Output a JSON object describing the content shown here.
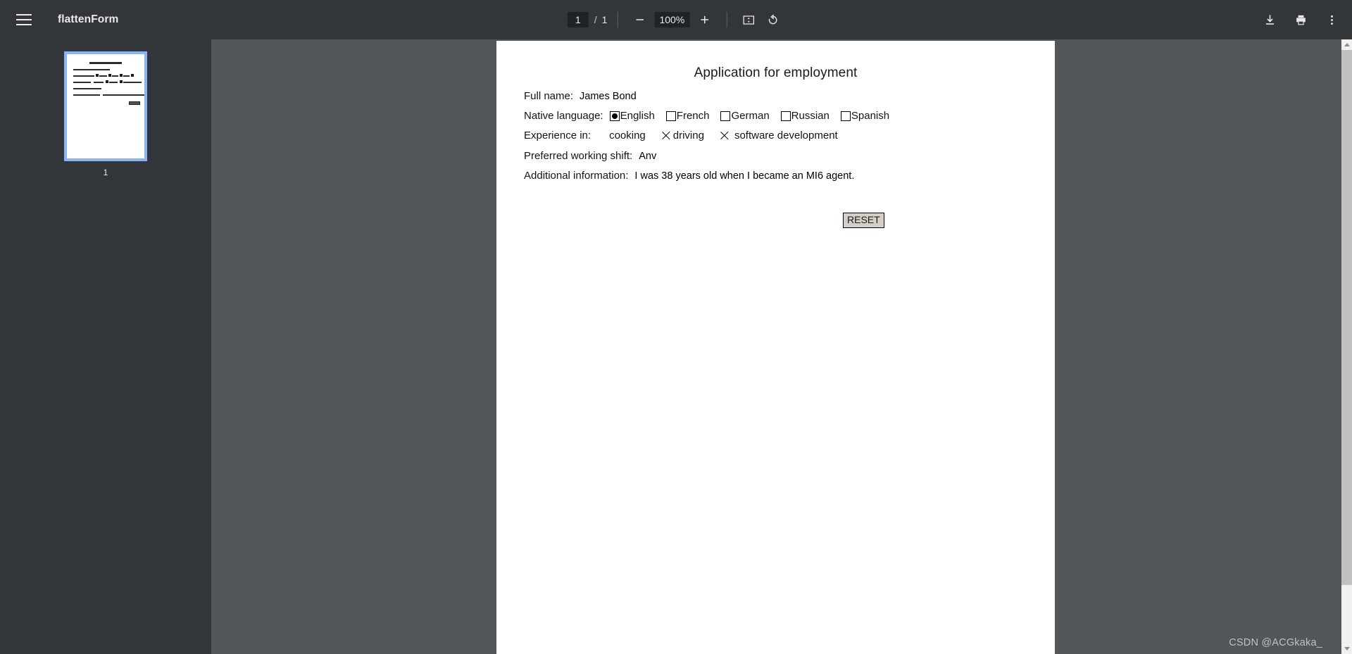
{
  "app": {
    "title": "flattenForm",
    "menu_icon": "hamburger-menu-icon"
  },
  "toolbar": {
    "page_current": "1",
    "page_separator": "/",
    "page_total": "1",
    "zoom_out_icon": "minus-icon",
    "zoom_level": "100%",
    "zoom_in_icon": "plus-icon",
    "fit_page_icon": "fit-to-page-icon",
    "rotate_icon": "rotate-counterclockwise-icon",
    "download_icon": "download-icon",
    "print_icon": "print-icon",
    "more_icon": "more-vertical-icon"
  },
  "sidebar": {
    "thumbnails": [
      {
        "page_label": "1",
        "selected": true
      }
    ]
  },
  "document": {
    "title": "Application for employment",
    "fields": {
      "full_name": {
        "label": "Full name:",
        "value": "James Bond"
      },
      "native_language": {
        "label": "Native language:",
        "options": [
          {
            "label": "English",
            "checked": true
          },
          {
            "label": "French",
            "checked": false
          },
          {
            "label": "German",
            "checked": false
          },
          {
            "label": "Russian",
            "checked": false
          },
          {
            "label": "Spanish",
            "checked": false
          }
        ]
      },
      "experience": {
        "label": "Experience in:",
        "options": [
          {
            "label": "cooking",
            "checked": false
          },
          {
            "label": "driving",
            "checked": true
          },
          {
            "label": "software development",
            "checked": true
          }
        ]
      },
      "preferred_shift": {
        "label": "Preferred working shift:",
        "value": "Anv"
      },
      "additional_information": {
        "label": "Additional information:",
        "value": "I was 38 years old when I became an MI6 agent."
      }
    },
    "reset_button_label": "RESET"
  },
  "watermark": {
    "text": "CSDN @ACGkaka_"
  },
  "colors": {
    "toolbar_bg": "#323639",
    "viewer_bg": "#525659",
    "thumbnail_selection": "#8ab4f8",
    "page_bg": "#ffffff",
    "toolbar_text": "#e8eaed",
    "reset_button_bg": "#d4d0c8"
  }
}
